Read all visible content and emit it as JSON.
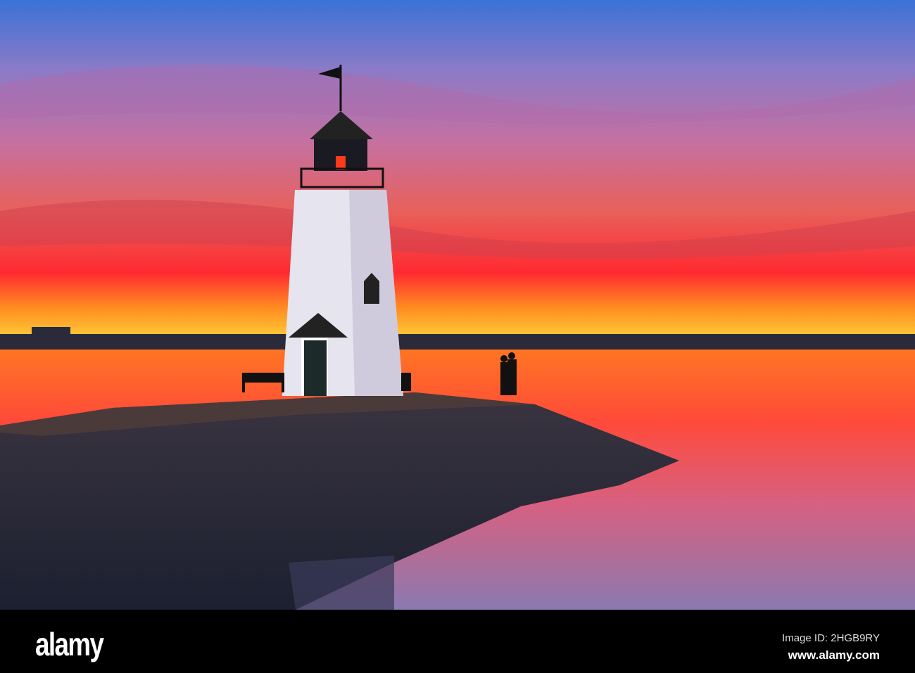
{
  "photo": {
    "subject": "lighthouse-at-sunset",
    "colors": {
      "sky_top": "#3b6fd0",
      "sky_mid": "#a86aa8",
      "sky_glow": "#ff2a2a",
      "horizon": "#ffc21a",
      "water": "#ff6a2a",
      "rocks": "#262a3a"
    }
  },
  "watermark": {
    "logo": "alamy"
  },
  "footer": {
    "logo": "alamy",
    "image_id": "Image ID: 2HGB9RY",
    "url": "www.alamy.com"
  }
}
